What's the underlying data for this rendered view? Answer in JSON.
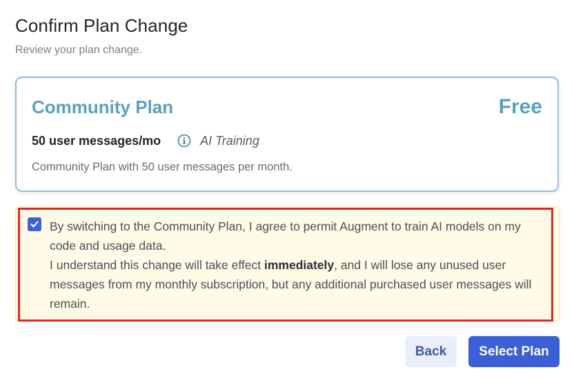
{
  "dialog": {
    "title": "Confirm Plan Change",
    "subtitle": "Review your plan change."
  },
  "plan": {
    "name": "Community Plan",
    "price": "Free",
    "messages": "50 user messages/mo",
    "info_icon": "info-circle-icon",
    "training": "AI Training",
    "description": "Community Plan with 50 user messages per month."
  },
  "consent": {
    "checked": true,
    "line1": "By switching to the Community Plan, I agree to permit Augment to train AI models on my code and usage data.",
    "line2_prefix": "I understand this change will take effect ",
    "line2_bold": "immediately",
    "line2_suffix": ", and I will lose any unused user messages from my monthly subscription, but any additional purchased user messages will remain."
  },
  "buttons": {
    "back": "Back",
    "select": "Select Plan"
  },
  "colors": {
    "accent": "#3a5fd6",
    "plan_teal": "#5aa1bd",
    "highlight_red": "#e8231f",
    "consent_bg": "#fffbe6"
  }
}
